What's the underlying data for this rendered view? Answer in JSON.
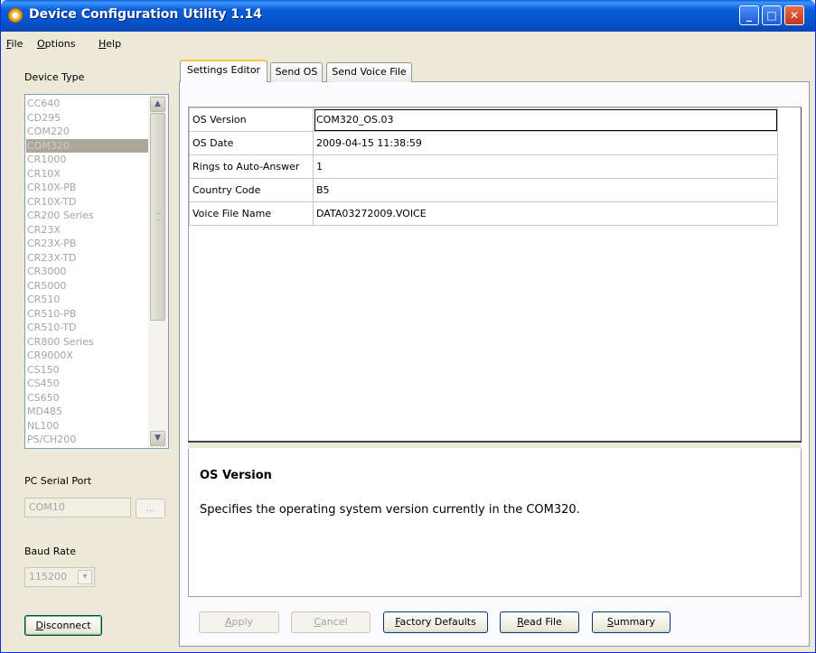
{
  "window": {
    "title": "Device Configuration Utility 1.14"
  },
  "title_buttons": {
    "minimize": "_",
    "maximize": "□",
    "close": "✕"
  },
  "menu": [
    {
      "label": "File",
      "mnemonic": "F",
      "rest": "ile"
    },
    {
      "label": "Options",
      "mnemonic": "O",
      "rest": "ptions"
    },
    {
      "label": "Help",
      "mnemonic": "H",
      "rest": "elp"
    }
  ],
  "left_panel": {
    "device_type_label": "Device Type",
    "devices": [
      "CC640",
      "CD295",
      "COM220",
      "COM320",
      "CR1000",
      "CR10X",
      "CR10X-PB",
      "CR10X-TD",
      "CR200 Series",
      "CR23X",
      "CR23X-PB",
      "CR23X-TD",
      "CR3000",
      "CR5000",
      "CR510",
      "CR510-PB",
      "CR510-TD",
      "CR800 Series",
      "CR9000X",
      "CS150",
      "CS450",
      "CS650",
      "MD485",
      "NL100",
      "PS/CH200"
    ],
    "selected_device": "COM320",
    "serial_port_label": "PC Serial Port",
    "serial_port_value": "COM10",
    "browse_label": "...",
    "baud_rate_label": "Baud Rate",
    "baud_rate_value": "115200",
    "disconnect_label": "Disconnect",
    "disconnect_mnemonic": "D",
    "disconnect_rest": "isconnect"
  },
  "tabs": [
    {
      "label": "Settings Editor",
      "active": true
    },
    {
      "label": "Send OS",
      "active": false
    },
    {
      "label": "Send Voice File",
      "active": false
    }
  ],
  "settings": [
    {
      "name": "OS Version",
      "value": "COM320_OS.03"
    },
    {
      "name": "OS Date",
      "value": "2009-04-15 11:38:59"
    },
    {
      "name": "Rings to Auto-Answer",
      "value": "1"
    },
    {
      "name": "Country Code",
      "value": "B5"
    },
    {
      "name": "Voice File Name",
      "value": "DATA03272009.VOICE"
    }
  ],
  "help": {
    "title": "OS Version",
    "description": "Specifies the operating system version currently in the COM320."
  },
  "buttons": {
    "apply": {
      "mnemonic": "A",
      "rest": "pply"
    },
    "cancel": {
      "mnemonic": "C",
      "rest": "ancel"
    },
    "factory_defaults": {
      "mnemonic": "F",
      "rest": "actory Defaults"
    },
    "read_file": {
      "mnemonic": "R",
      "rest": "ead File"
    },
    "summary": {
      "mnemonic": "S",
      "rest": "ummary"
    }
  },
  "icons": {
    "scroll_up": "▲",
    "scroll_down": "▼",
    "dropdown": "▾"
  }
}
